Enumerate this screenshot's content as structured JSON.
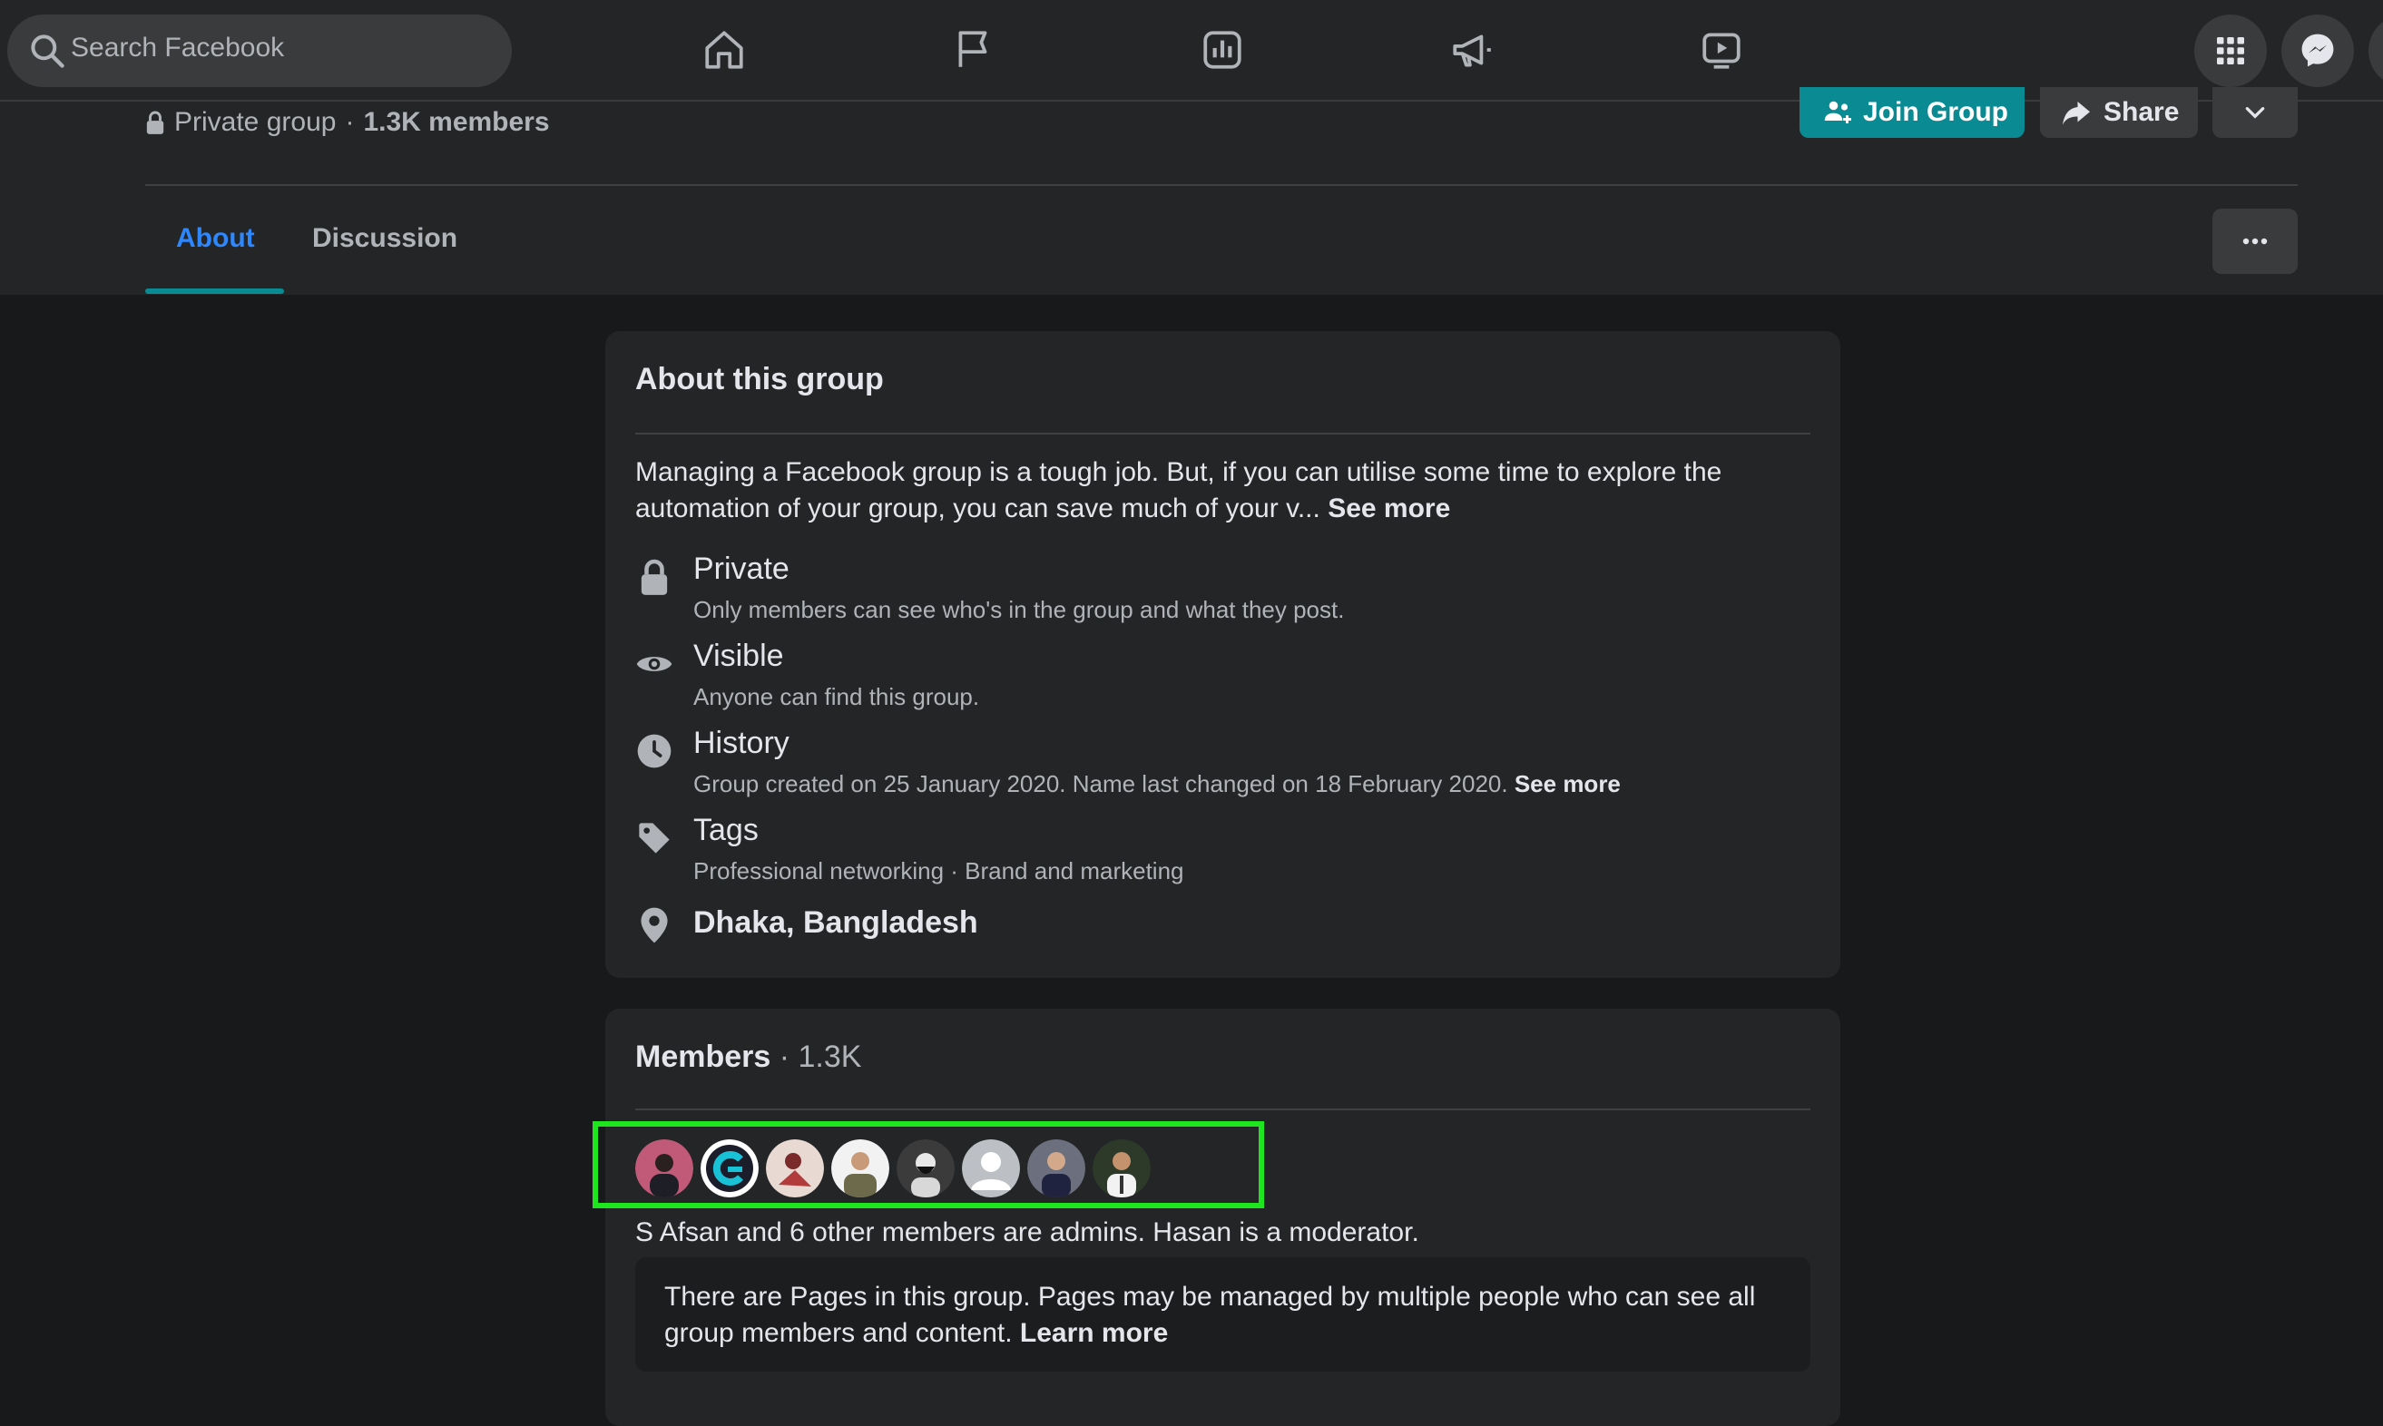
{
  "topbar": {
    "search_placeholder": "Search Facebook",
    "nav_icons": [
      "home-icon",
      "flag-icon",
      "chart-icon",
      "megaphone-icon",
      "video-icon"
    ],
    "right_icons": [
      "grid-menu-icon",
      "messenger-icon"
    ]
  },
  "group": {
    "privacy": "Private group",
    "members_count": "1.3K members",
    "join_label": "Join Group",
    "share_label": "Share"
  },
  "tabs": [
    {
      "label": "About",
      "active": true
    },
    {
      "label": "Discussion",
      "active": false
    }
  ],
  "about": {
    "title": "About this group",
    "description": "Managing a Facebook group is a tough job. But, if you can utilise some time to explore the automation of your group, you can save much of your v...",
    "see_more": "See more",
    "rows": [
      {
        "icon": "lock-icon",
        "title": "Private",
        "subtitle": "Only members can see who's in the group and what they post."
      },
      {
        "icon": "eye-icon",
        "title": "Visible",
        "subtitle": "Anyone can find this group."
      },
      {
        "icon": "clock-icon",
        "title": "History",
        "subtitle": "Group created on 25 January 2020. Name last changed on 18 February 2020.",
        "link": "See more"
      },
      {
        "icon": "tag-icon",
        "title": "Tags",
        "subtitle": "Professional networking · Brand and marketing"
      },
      {
        "icon": "location-icon",
        "title": "Dhaka, Bangladesh"
      }
    ]
  },
  "members": {
    "title": "Members",
    "count": "· 1.3K",
    "admins_line": "S Afsan and 6 other members are admins. Hasan is a moderator.",
    "pages_notice": "There are Pages in this group. Pages may be managed by multiple people who can see all group members and content.",
    "learn_more": "Learn more",
    "avatar_colors": [
      "#c05a78",
      "#ffffff",
      "#e8d9d2",
      "#f2f2f2",
      "#3b3b3b",
      "#bcc0c4",
      "#6b6f7e",
      "#2d3a2a"
    ]
  },
  "colors": {
    "accent": "#0a8b93",
    "link": "#2d88ff",
    "highlight": "#1ee51e"
  }
}
